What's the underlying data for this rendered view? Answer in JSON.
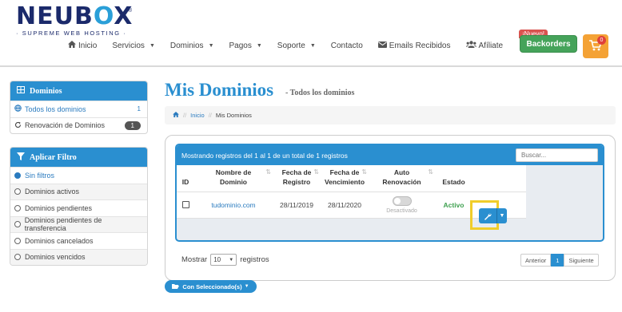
{
  "brand": {
    "name_part1": "NEUB",
    "name_o": "O",
    "name_part2": "X",
    "registered": "®",
    "tagline": "· SUPREME WEB HOSTING ·"
  },
  "nav": {
    "items": [
      {
        "label": "Inicio",
        "icon": "home-icon",
        "dropdown": false
      },
      {
        "label": "Servicios",
        "dropdown": true
      },
      {
        "label": "Dominios",
        "dropdown": true
      },
      {
        "label": "Pagos",
        "dropdown": true
      },
      {
        "label": "Soporte",
        "dropdown": true
      },
      {
        "label": "Contacto",
        "dropdown": false
      },
      {
        "label": "Emails Recibidos",
        "icon": "envelope-icon",
        "dropdown": false
      },
      {
        "label": "Afíliate",
        "icon": "users-icon",
        "dropdown": false
      }
    ],
    "nuevo_badge": "¡Nuevo!",
    "backorders": "Backorders",
    "cart_count": "0"
  },
  "sidebar": {
    "domains_panel": {
      "title": "Dominios",
      "items": [
        {
          "label": "Todos los dominios",
          "count": "1",
          "icon": "globe-icon",
          "active": true
        },
        {
          "label": "Renovación de Dominios",
          "count": "1",
          "icon": "refresh-icon",
          "active": false
        }
      ]
    },
    "filter_panel": {
      "title": "Aplicar Filtro",
      "items": [
        {
          "label": "Sin filtros",
          "selected": true
        },
        {
          "label": "Dominios activos",
          "selected": false
        },
        {
          "label": "Dominios pendientes",
          "selected": false
        },
        {
          "label": "Dominios pendientes de transferencia",
          "selected": false
        },
        {
          "label": "Dominios cancelados",
          "selected": false
        },
        {
          "label": "Dominios vencidos",
          "selected": false
        }
      ]
    }
  },
  "main": {
    "title": "Mis Dominios",
    "subtitle": "- Todos los dominios",
    "breadcrumb": {
      "home_link": "Inicio",
      "separator": "//",
      "current": "Mis Dominios"
    },
    "table": {
      "info": "Mostrando registros del 1 al 1 de un total de 1 registros",
      "search_placeholder": "Buscar...",
      "headers": [
        "ID",
        "Nombre de Dominio",
        "Fecha de Registro",
        "Fecha de Vencimiento",
        "Auto Renovación",
        "Estado",
        ""
      ],
      "rows": [
        {
          "domain": "tudominio.com",
          "registered": "28/11/2019",
          "expires": "28/11/2020",
          "auto_renew": "Desactivado",
          "status": "Activo"
        }
      ]
    },
    "length": {
      "prefix": "Mostrar",
      "value": "10",
      "suffix": "registros"
    },
    "pager": {
      "prev": "Anterior",
      "current": "1",
      "next": "Siguiente"
    },
    "bulk_button": "Con Seleccionado(s)"
  },
  "colors": {
    "primary": "#2a8fd0",
    "success": "#45a35a",
    "cart": "#f4a235",
    "highlight": "#f0cd2a"
  }
}
